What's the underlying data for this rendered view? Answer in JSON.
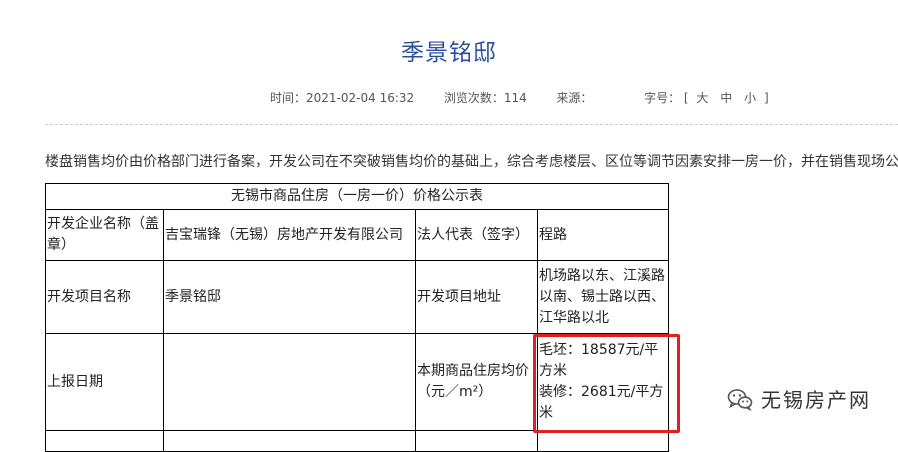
{
  "article": {
    "title": "季景铭邸",
    "meta": {
      "time_label": "时间：",
      "time_value": "2021-02-04 16:32",
      "views_label": "浏览次数：",
      "views_value": "114",
      "source_label": "来源：",
      "fontsize_label": "字号：",
      "fontsize_open": "[",
      "fontsize_large": "大",
      "fontsize_medium": "中",
      "fontsize_small": "小",
      "fontsize_close": "]"
    },
    "intro": "楼盘销售均价由价格部门进行备案，开发公司在不突破销售均价的基础上，综合考虑楼层、区位等调节因素安排一房一价，并在销售现场公"
  },
  "table": {
    "caption": "无锡市商品住房（一房一价）价格公示表",
    "developer_label": "开发企业名称（盖章）",
    "developer_value": "吉宝瑞锋（无锡）房地产开发有限公司",
    "legal_rep_label": "法人代表（签字）",
    "legal_rep_value": "程路",
    "project_label": "开发项目名称",
    "project_value": "季景铭邸",
    "address_label": "开发项目地址",
    "address_value": "机场路以东、江溪路以南、锡士路以西、江华路以北",
    "report_date_label": "上报日期",
    "report_date_value": "",
    "avg_price_label": "本期商品住房均价（元／m²）",
    "avg_price_rough": "毛坯：18587元/平方米",
    "avg_price_decor": "装修：2681元/平方米"
  },
  "watermark": {
    "text": "无锡房产网",
    "icon": "wechat-icon"
  },
  "colors": {
    "title": "#2b4f9c",
    "highlight_box": "#e02020"
  }
}
